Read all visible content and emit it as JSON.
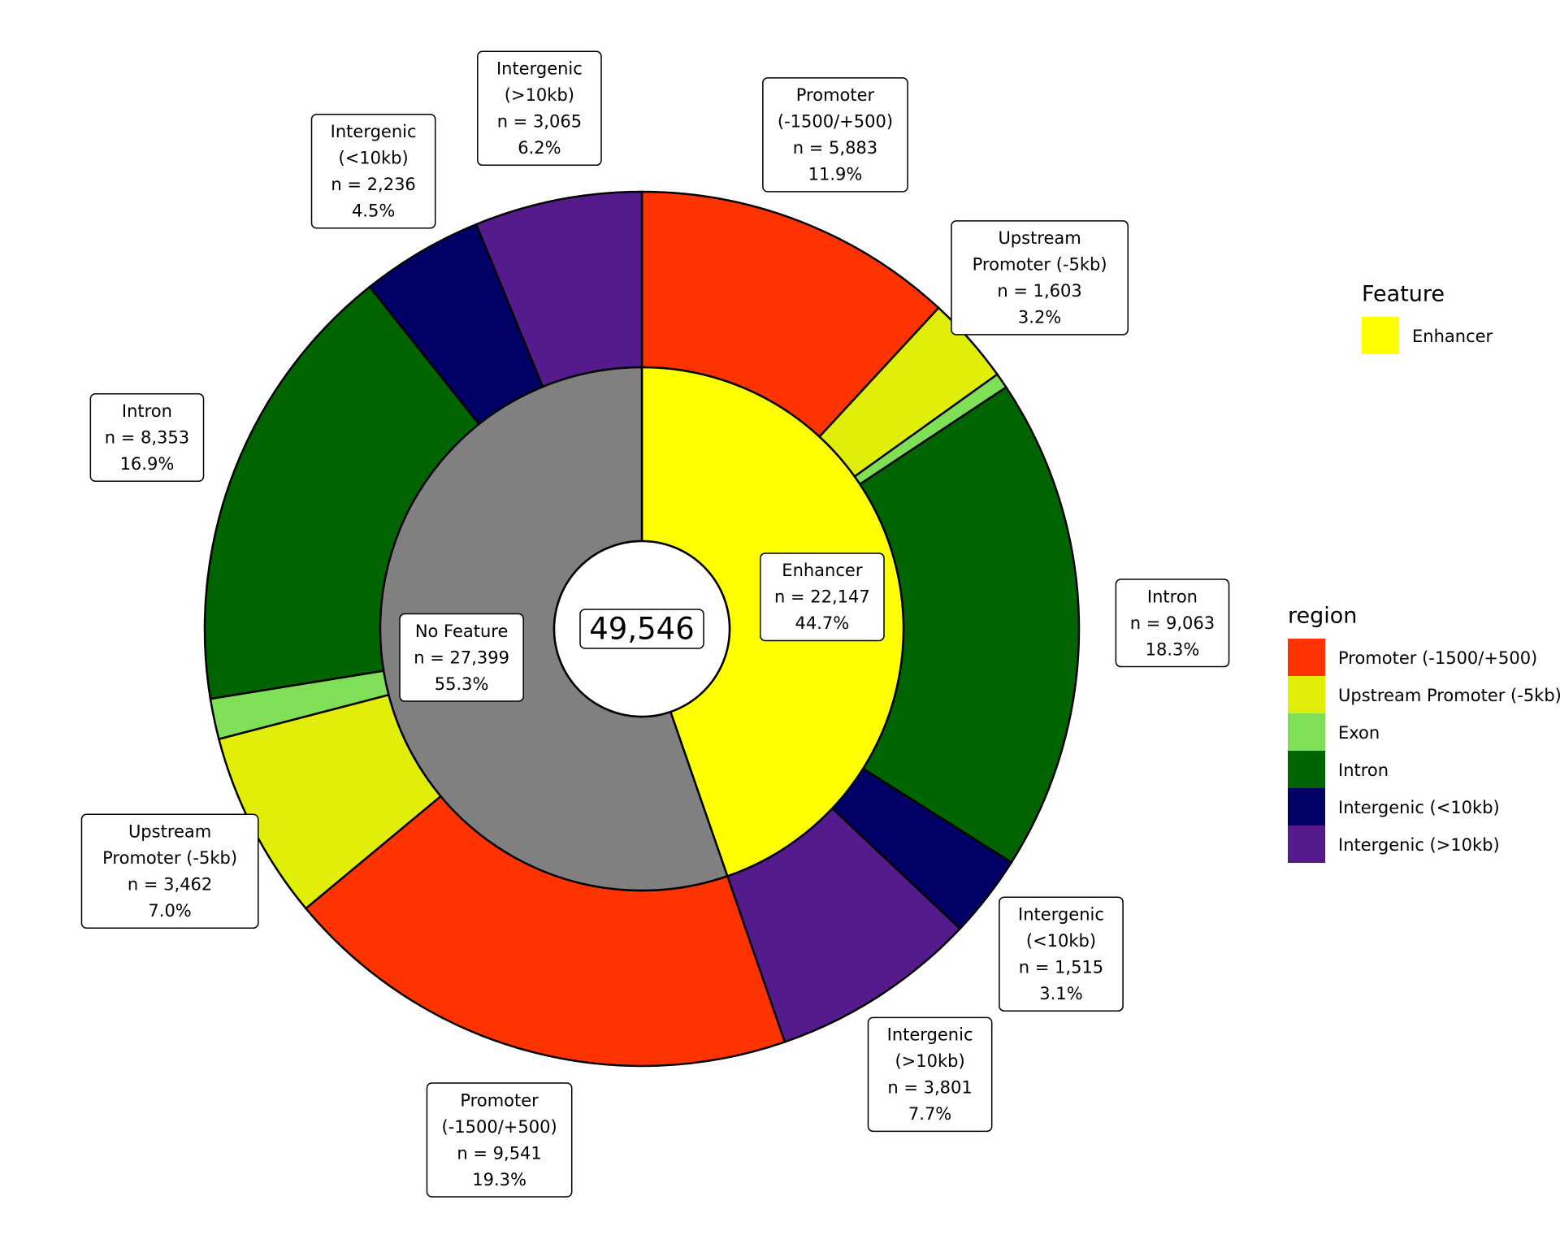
{
  "chart_data": {
    "type": "pie",
    "subtype": "nested-donut",
    "total_label": "49,546",
    "total": 49546,
    "inner_ring": {
      "name": "Feature",
      "slices": [
        {
          "label": "Enhancer",
          "n": 22147,
          "n_text": "n = 22,147",
          "pct_text": "44.7%",
          "color": "#FFFF00"
        },
        {
          "label": "No Feature",
          "n": 27399,
          "n_text": "n = 27,399",
          "pct_text": "55.3%",
          "color": "#808080"
        }
      ]
    },
    "outer_ring": {
      "name": "region",
      "slices": [
        {
          "parent": "Enhancer",
          "region": "Promoter (-1500/+500)",
          "label_lines": [
            "Promoter",
            "(-1500/+500)"
          ],
          "n": 5883,
          "n_text": "n = 5,883",
          "pct_text": "11.9%",
          "color": "#FF3300",
          "labeled": true
        },
        {
          "parent": "Enhancer",
          "region": "Upstream Promoter (-5kb)",
          "label_lines": [
            "Upstream",
            "Promoter (-5kb)"
          ],
          "n": 1603,
          "n_text": "n = 1,603",
          "pct_text": "3.2%",
          "color": "#E0EE0A",
          "labeled": true
        },
        {
          "parent": "Enhancer",
          "region": "Exon",
          "label_lines": [
            "Exon"
          ],
          "n": 282,
          "n_text": "",
          "pct_text": "",
          "color": "#7FDF56",
          "labeled": false
        },
        {
          "parent": "Enhancer",
          "region": "Intron",
          "label_lines": [
            "Intron"
          ],
          "n": 9063,
          "n_text": "n = 9,063",
          "pct_text": "18.3%",
          "color": "#006400",
          "labeled": true
        },
        {
          "parent": "Enhancer",
          "region": "Intergenic (<10kb)",
          "label_lines": [
            "Intergenic",
            "(<10kb)"
          ],
          "n": 1515,
          "n_text": "n = 1,515",
          "pct_text": "3.1%",
          "color": "#000066",
          "labeled": true
        },
        {
          "parent": "Enhancer",
          "region": "Intergenic (>10kb)",
          "label_lines": [
            "Intergenic",
            "(>10kb)"
          ],
          "n": 3801,
          "n_text": "n = 3,801",
          "pct_text": "7.7%",
          "color": "#551A8B",
          "labeled": true
        },
        {
          "parent": "No Feature",
          "region": "Promoter (-1500/+500)",
          "label_lines": [
            "Promoter",
            "(-1500/+500)"
          ],
          "n": 9541,
          "n_text": "n = 9,541",
          "pct_text": "19.3%",
          "color": "#FF3300",
          "labeled": true
        },
        {
          "parent": "No Feature",
          "region": "Upstream Promoter (-5kb)",
          "label_lines": [
            "Upstream",
            "Promoter (-5kb)"
          ],
          "n": 3462,
          "n_text": "n = 3,462",
          "pct_text": "7.0%",
          "color": "#E0EE0A",
          "labeled": true
        },
        {
          "parent": "No Feature",
          "region": "Exon",
          "label_lines": [
            "Exon"
          ],
          "n": 742,
          "n_text": "",
          "pct_text": "",
          "color": "#7FDF56",
          "labeled": false
        },
        {
          "parent": "No Feature",
          "region": "Intron",
          "label_lines": [
            "Intron"
          ],
          "n": 8353,
          "n_text": "n = 8,353",
          "pct_text": "16.9%",
          "color": "#006400",
          "labeled": true
        },
        {
          "parent": "No Feature",
          "region": "Intergenic (<10kb)",
          "label_lines": [
            "Intergenic",
            "(<10kb)"
          ],
          "n": 2236,
          "n_text": "n = 2,236",
          "pct_text": "4.5%",
          "color": "#000066",
          "labeled": true
        },
        {
          "parent": "No Feature",
          "region": "Intergenic (>10kb)",
          "label_lines": [
            "Intergenic",
            "(>10kb)"
          ],
          "n": 3065,
          "n_text": "n = 3,065",
          "pct_text": "6.2%",
          "color": "#551A8B",
          "labeled": true
        }
      ]
    },
    "legends": [
      {
        "title": "Feature",
        "placement": "right-top",
        "entries": [
          {
            "label": "Enhancer",
            "color": "#FFFF00"
          }
        ]
      },
      {
        "title": "region",
        "placement": "right-middle",
        "entries": [
          {
            "label": "Promoter (-1500/+500)",
            "color": "#FF3300"
          },
          {
            "label": "Upstream Promoter (-5kb)",
            "color": "#E0EE0A"
          },
          {
            "label": "Exon",
            "color": "#7FDF56"
          },
          {
            "label": "Intron",
            "color": "#006400"
          },
          {
            "label": "Intergenic (<10kb)",
            "color": "#000066"
          },
          {
            "label": "Intergenic (>10kb)",
            "color": "#551A8B"
          }
        ]
      }
    ],
    "title": "",
    "hole_color": "#FFFFFF"
  }
}
